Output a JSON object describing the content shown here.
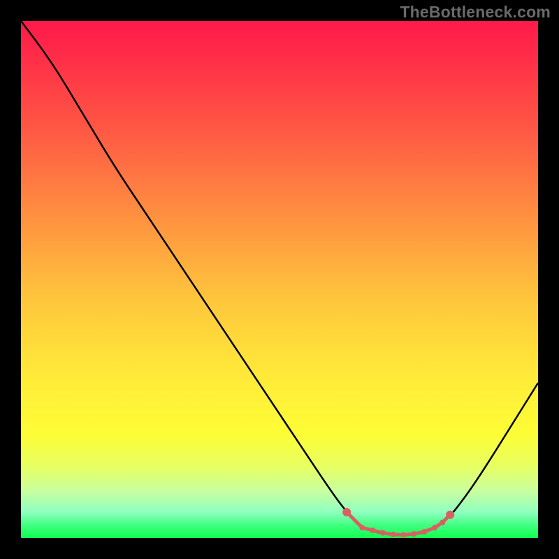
{
  "watermark": "TheBottleneck.com",
  "chart_data": {
    "type": "line",
    "title": "",
    "xlabel": "",
    "ylabel": "",
    "xlim": [
      0,
      100
    ],
    "ylim": [
      0,
      100
    ],
    "background": {
      "type": "vertical-gradient",
      "description": "red (top) through orange, yellow, to green (bottom)",
      "stops": [
        {
          "pos": 0,
          "color": "#ff1a4a"
        },
        {
          "pos": 50,
          "color": "#ffc63c"
        },
        {
          "pos": 80,
          "color": "#fdfd36"
        },
        {
          "pos": 100,
          "color": "#10ff50"
        }
      ]
    },
    "series": [
      {
        "name": "bottleneck-curve",
        "color": "#000000",
        "values": [
          {
            "x": 0,
            "y": 100
          },
          {
            "x": 6,
            "y": 92
          },
          {
            "x": 12,
            "y": 82
          },
          {
            "x": 18,
            "y": 72
          },
          {
            "x": 24,
            "y": 63
          },
          {
            "x": 30,
            "y": 54
          },
          {
            "x": 36,
            "y": 45
          },
          {
            "x": 42,
            "y": 36
          },
          {
            "x": 48,
            "y": 27
          },
          {
            "x": 54,
            "y": 18
          },
          {
            "x": 60,
            "y": 9
          },
          {
            "x": 63,
            "y": 5
          },
          {
            "x": 66,
            "y": 2
          },
          {
            "x": 69,
            "y": 1
          },
          {
            "x": 72,
            "y": 0.5
          },
          {
            "x": 75,
            "y": 0.5
          },
          {
            "x": 78,
            "y": 1
          },
          {
            "x": 82,
            "y": 3
          },
          {
            "x": 86,
            "y": 8
          },
          {
            "x": 90,
            "y": 14
          },
          {
            "x": 95,
            "y": 22
          },
          {
            "x": 100,
            "y": 30
          }
        ]
      },
      {
        "name": "optimal-zone-markers",
        "color": "#d86060",
        "marker": "dot",
        "values": [
          {
            "x": 63,
            "y": 5
          },
          {
            "x": 66,
            "y": 2
          },
          {
            "x": 68,
            "y": 1.5
          },
          {
            "x": 70,
            "y": 1
          },
          {
            "x": 72,
            "y": 0.7
          },
          {
            "x": 74,
            "y": 0.6
          },
          {
            "x": 76,
            "y": 0.8
          },
          {
            "x": 78,
            "y": 1.2
          },
          {
            "x": 80,
            "y": 2
          },
          {
            "x": 81.5,
            "y": 3
          },
          {
            "x": 83,
            "y": 4.5
          }
        ]
      }
    ]
  }
}
